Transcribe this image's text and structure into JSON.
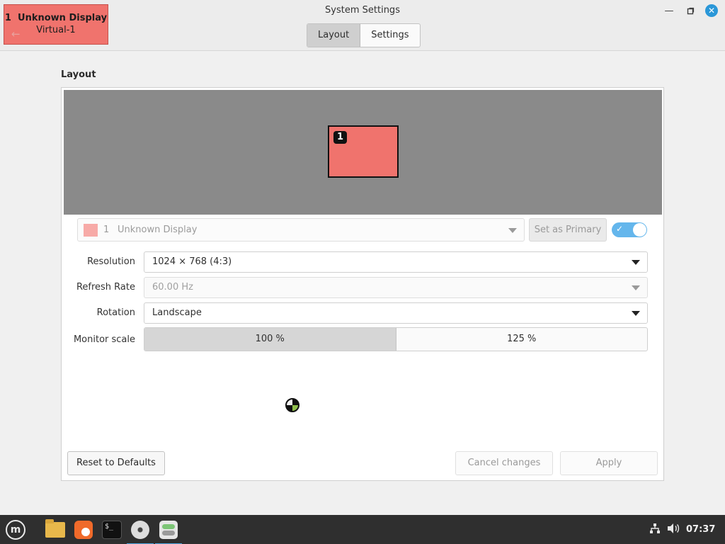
{
  "window": {
    "title": "System Settings",
    "tabs": [
      {
        "label": "Layout",
        "active": true
      },
      {
        "label": "Settings",
        "active": false
      }
    ],
    "controls": {
      "minimize_icon": "minimize-icon",
      "maximize_icon": "maximize-icon",
      "close_icon": "close-icon"
    }
  },
  "identify_overlay": {
    "number": "1",
    "name": "Unknown Display",
    "connector": "Virtual-1",
    "color": "#f0736d"
  },
  "layout": {
    "section_title": "Layout",
    "canvas_color": "#8a8a8a",
    "monitor": {
      "number": "1",
      "color": "#f0736d"
    }
  },
  "display_selector": {
    "number": "1",
    "name": "Unknown Display",
    "swatch_color": "#f7aaa7"
  },
  "set_primary_label": "Set as Primary",
  "enabled_toggle": {
    "on": true,
    "color": "#64b6ec"
  },
  "settings": {
    "resolution": {
      "label": "Resolution",
      "value": "1024 × 768 (4:3)"
    },
    "refresh_rate": {
      "label": "Refresh Rate",
      "value": "60.00 Hz",
      "disabled": true
    },
    "rotation": {
      "label": "Rotation",
      "value": "Landscape"
    },
    "monitor_scale": {
      "label": "Monitor scale",
      "options": [
        {
          "label": "100 %",
          "selected": true
        },
        {
          "label": "125 %",
          "selected": false
        }
      ]
    }
  },
  "footer": {
    "reset_label": "Reset to Defaults",
    "cancel_label": "Cancel changes",
    "apply_label": "Apply"
  },
  "taskbar": {
    "items": [
      "mint-menu-icon",
      "files-icon",
      "firefox-icon",
      "terminal-icon",
      "disc-icon",
      "settings-icon"
    ],
    "tray": [
      "network-icon",
      "volume-icon"
    ],
    "clock": "07:37"
  }
}
